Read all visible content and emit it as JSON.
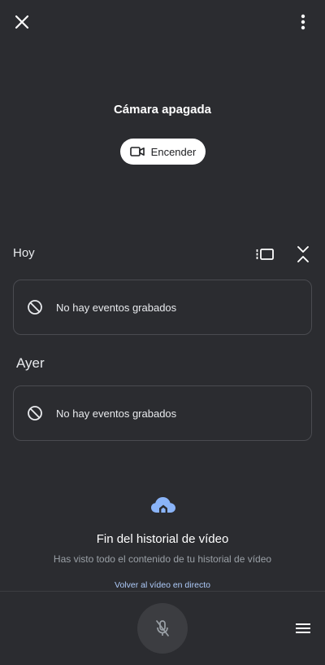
{
  "top_bar": {
    "close_icon": "close-icon",
    "more_icon": "more-vert-icon"
  },
  "camera": {
    "status": "Cámara apagada",
    "turn_on_label": "Encender",
    "turn_on_icon": "videocam-icon"
  },
  "history": {
    "sections": [
      {
        "label": "Hoy",
        "empty_text": "No hay eventos grabados"
      },
      {
        "label": "Ayer",
        "empty_text": "No hay eventos grabados"
      }
    ],
    "view_toggle_icon": "view-carousel-icon",
    "collapse_icon": "unfold-less-icon",
    "empty_icon": "block-icon"
  },
  "end_of_history": {
    "icon": "cloud-home-icon",
    "title": "Fin del historial de vídeo",
    "subtitle": "Has visto todo el contenido de tu historial de vídeo",
    "live_link": "Volver al vídeo en directo"
  },
  "bottom_bar": {
    "mic_icon": "mic-off-icon",
    "menu_icon": "menu-icon"
  },
  "colors": {
    "background": "#2b2c30",
    "card_border": "#4a4b50",
    "link": "#aecbfa",
    "cloud_accent": "#8ab4f8"
  }
}
